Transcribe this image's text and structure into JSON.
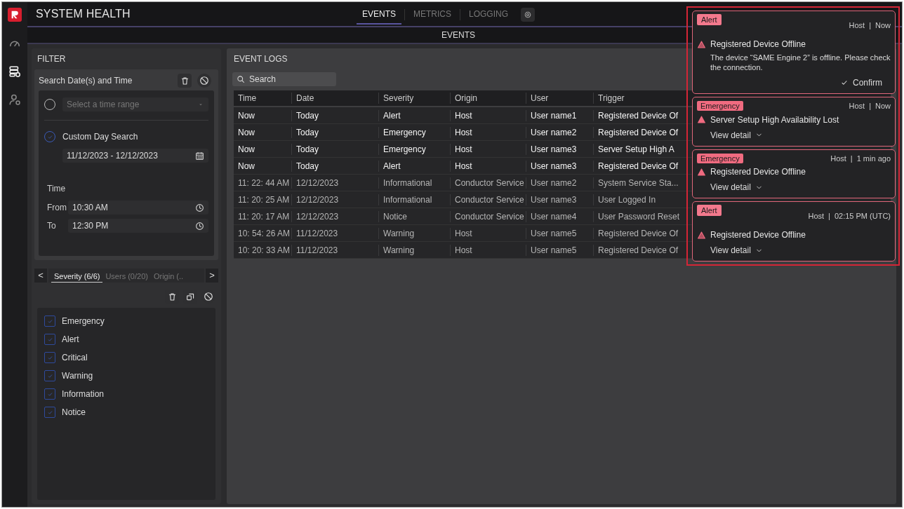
{
  "app": {
    "title": "SYSTEM HEALTH"
  },
  "rail": [
    {
      "selected": false
    },
    {
      "selected": true
    },
    {
      "selected": false
    }
  ],
  "tabs": [
    {
      "label": "EVENTS",
      "selected": true
    },
    {
      "label": "METRICS",
      "selected": false
    },
    {
      "label": "LOGGING",
      "selected": false
    }
  ],
  "subheader": "EVENTS",
  "filter": {
    "title": "FILTER",
    "date_card": {
      "title": "Search Date(s) and Time",
      "options": [
        {
          "kind": "select",
          "selected": false,
          "placeholder": "Select a time range"
        },
        {
          "kind": "custom",
          "selected": true,
          "label": "Custom Day Search",
          "value": "11/12/2023 - 12/12/2023"
        }
      ],
      "time_label": "Time",
      "from_label": "From",
      "from_value": "10:30 AM",
      "to_label": "To",
      "to_value": "12:30 PM"
    },
    "tabs_prev": "<",
    "tabs_next": ">",
    "tabs": [
      {
        "label": "Severity (6/6)",
        "selected": true
      },
      {
        "label": "Users (0/20)",
        "selected": false
      },
      {
        "label": "Origin (..",
        "selected": false
      }
    ],
    "checklist": [
      {
        "label": "Emergency",
        "checked": true
      },
      {
        "label": "Alert",
        "checked": true
      },
      {
        "label": "Critical",
        "checked": true
      },
      {
        "label": "Warning",
        "checked": true
      },
      {
        "label": "Information",
        "checked": true
      },
      {
        "label": "Notice",
        "checked": true
      }
    ]
  },
  "event_logs": {
    "title": "EVENT LOGS",
    "search": {
      "placeholder": "Search"
    },
    "columns": [
      "Time",
      "Date",
      "Severity",
      "Origin",
      "User",
      "Trigger"
    ],
    "rows": [
      {
        "unread": true,
        "cells": [
          "Now",
          "Today",
          "Alert",
          "Host",
          "User name1",
          "Registered Device Of"
        ]
      },
      {
        "unread": true,
        "cells": [
          "Now",
          "Today",
          "Emergency",
          "Host",
          "User name2",
          "Registered Device Of"
        ]
      },
      {
        "unread": true,
        "cells": [
          "Now",
          "Today",
          "Emergency",
          "Host",
          "User name3",
          "Server Setup High A"
        ]
      },
      {
        "unread": true,
        "cells": [
          "Now",
          "Today",
          "Alert",
          "Host",
          "User name3",
          "Registered Device Of"
        ]
      },
      {
        "unread": false,
        "cells": [
          "11: 22: 44 AM",
          "12/12/2023",
          "Informational",
          "Conductor Service",
          "User name2",
          "System Service Sta..."
        ]
      },
      {
        "unread": false,
        "cells": [
          "11: 20: 25 AM",
          "12/12/2023",
          "Informational",
          "Conductor Service",
          "User name3",
          "User Logged In"
        ]
      },
      {
        "unread": false,
        "cells": [
          "11: 20: 17 AM",
          "12/12/2023",
          "Notice",
          "Conductor Service",
          "User name4",
          "User Password Reset"
        ]
      },
      {
        "unread": false,
        "cells": [
          "10: 54: 26 AM",
          "11/12/2023",
          "Warning",
          "Host",
          "User name5",
          "Registered Device Of"
        ]
      },
      {
        "unread": false,
        "cells": [
          "10: 20: 33 AM",
          "11/12/2023",
          "Warning",
          "Host",
          "User name5",
          "Registered Device Of"
        ]
      }
    ]
  },
  "notifications": [
    {
      "kind": "alert",
      "badge": "Alert",
      "origin": "Host",
      "separator": "|",
      "time": "Now",
      "title": "Registered Device Offline",
      "message": "The device “SAME Engine 2” is offline. Please check the connection.",
      "action": "Confirm"
    },
    {
      "kind": "emergency",
      "badge": "Emergency",
      "origin": "Host",
      "separator": "|",
      "time": "Now",
      "title": "Server Setup High Availability Lost",
      "action": "View detail"
    },
    {
      "kind": "emergency",
      "badge": "Emergency",
      "origin": "Host",
      "separator": "|",
      "time": "1 min ago",
      "title": "Registered Device Offline",
      "action": "View detail"
    },
    {
      "kind": "alert",
      "badge": "Alert",
      "origin": "Host",
      "separator": "|",
      "time": "02:15 PM (UTC)",
      "title": "Registered Device Offline",
      "action": "View detail"
    }
  ]
}
